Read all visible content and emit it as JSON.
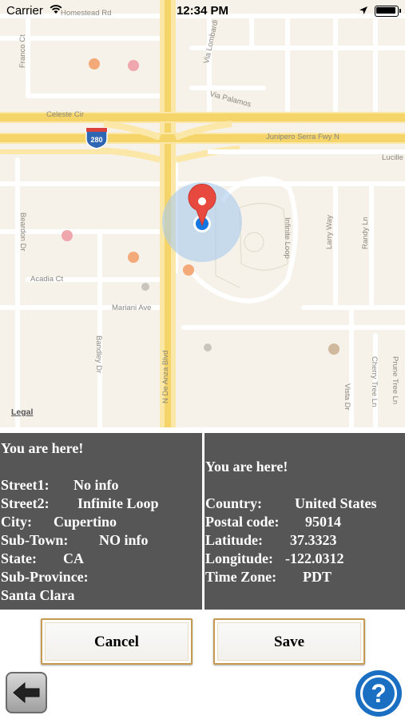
{
  "status_bar": {
    "carrier": "Carrier",
    "time": "12:34 PM",
    "wifi_icon": "wifi-icon",
    "location_icon": "location-arrow-icon",
    "battery_icon": "battery-icon"
  },
  "map": {
    "legal": "Legal",
    "highway_shield": "280",
    "streets": {
      "homestead": "Homestead Rd",
      "franco": "Franco Ct",
      "via_lombardi": "Via Lombardi",
      "via_palamos": "Via Palamos",
      "celeste": "Celeste Cir",
      "junipero": "Junipero Serra Fwy N",
      "lucille": "Lucille",
      "beardon": "Beardon Dr",
      "infinite_loop": "Infinite Loop",
      "larry": "Larry Way",
      "randy": "Randy Ln",
      "acadia": "Acadia Ct",
      "mariani": "Mariani Ave",
      "bandley": "Bandley Dr",
      "de_anza": "N De Anza Blvd",
      "vista": "Vista Dr",
      "cherry": "Cherry Tree Ln",
      "prune": "Prune Tree Ln"
    },
    "pin_icon": "map-pin-icon",
    "user_location_icon": "user-location-dot-icon"
  },
  "left_panel": {
    "title": "You are here!",
    "street1_label": "Street1:",
    "street1_value": "No info",
    "street2_label": "Street2:",
    "street2_value": "Infinite Loop",
    "city_label": "City:",
    "city_value": "Cupertino",
    "subtown_label": "Sub-Town:",
    "subtown_value": "NO info",
    "state_label": "State:",
    "state_value": "CA",
    "subprovince_label": "Sub-Province:",
    "subprovince_value": "Santa Clara"
  },
  "right_panel": {
    "title": "You are here!",
    "country_label": "Country:",
    "country_value": "United States",
    "postal_label": "Postal code:",
    "postal_value": "95014",
    "latitude_label": "Latitude:",
    "latitude_value": "37.3323",
    "longitude_label": "Longitude:",
    "longitude_value": "-122.0312",
    "timezone_label": "Time Zone:",
    "timezone_value": "PDT"
  },
  "buttons": {
    "cancel": "Cancel",
    "save": "Save",
    "back_icon": "back-arrow-icon",
    "help_icon": "help-question-icon"
  },
  "colors": {
    "panel_bg": "#565656",
    "button_border": "#c79a52",
    "help_blue": "#1b6fc2",
    "pin_red": "#e8493e",
    "user_dot_blue": "#1676e0",
    "highway_yellow": "#f7d96b"
  }
}
